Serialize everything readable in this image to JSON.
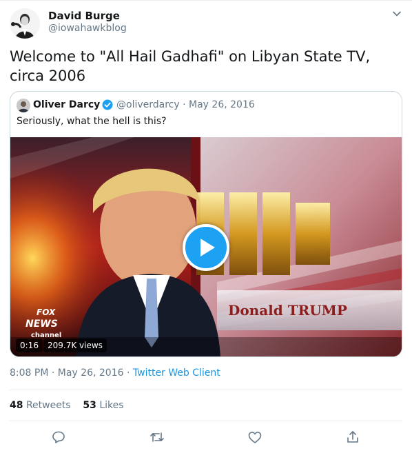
{
  "author": {
    "name": "David Burge",
    "handle": "@iowahawkblog"
  },
  "tweet": {
    "text": "Welcome to \"All Hail Gadhafi\" on Libyan State TV, circa 2006"
  },
  "quoted": {
    "name": "Oliver Darcy",
    "handle": "@oliverdarcy",
    "separator": "·",
    "date": "May 26, 2016",
    "text": "Seriously, what the hell is this?"
  },
  "video": {
    "duration": "0:16",
    "views": "209.7K views",
    "caption": "Donald TRUMP",
    "logo_top": "FOX",
    "logo_mid": "NEWS",
    "logo_bottom": "channel"
  },
  "meta": {
    "time": "8:08 PM",
    "sep1": "·",
    "date": "May 26, 2016",
    "sep2": "·",
    "client": "Twitter Web Client"
  },
  "stats": {
    "retweets_count": "48",
    "retweets_label": "Retweets",
    "likes_count": "53",
    "likes_label": "Likes"
  },
  "icons": {
    "caret": "chevron-down-icon",
    "verified": "verified-badge-icon",
    "play": "play-icon",
    "reply": "reply-icon",
    "retweet": "retweet-icon",
    "like": "like-icon",
    "share": "share-icon"
  },
  "colors": {
    "accent": "#1da1f2",
    "link": "#1b95e0",
    "muted": "#657786",
    "text": "#14171a",
    "border": "#e6ecf0"
  }
}
